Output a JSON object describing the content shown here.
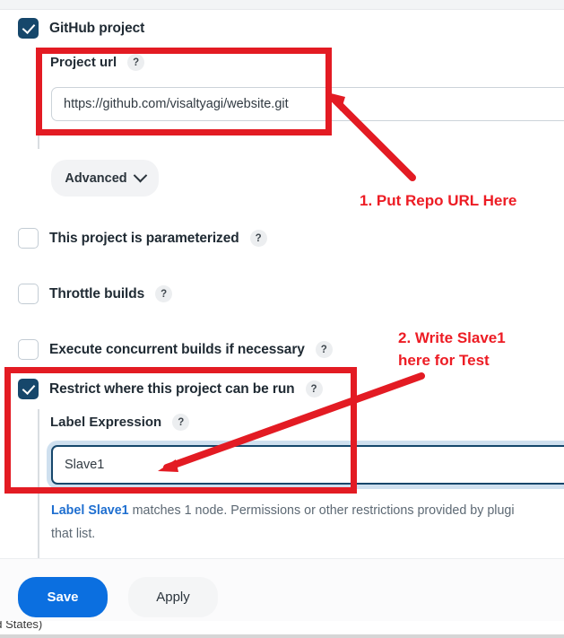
{
  "form": {
    "github_project": {
      "label": "GitHub project",
      "checked": true,
      "project_url_label": "Project url",
      "help_glyph": "?",
      "project_url_value": "https://github.com/visaltyagi/website.git",
      "advanced_label": "Advanced"
    },
    "checkboxes": [
      {
        "label": "This project is parameterized",
        "checked": false,
        "help_glyph": "?"
      },
      {
        "label": "Throttle builds",
        "checked": false,
        "help_glyph": "?"
      },
      {
        "label": "Execute concurrent builds if necessary",
        "checked": false,
        "help_glyph": "?"
      },
      {
        "label": "Restrict where this project can be run",
        "checked": true,
        "help_glyph": "?"
      }
    ],
    "label_expression": {
      "label": "Label Expression",
      "help_glyph": "?",
      "value": "Slave1",
      "note_link": "Label Slave1",
      "note_rest": " matches 1 node. Permissions or other restrictions provided by plugi",
      "note_line2": "that list."
    }
  },
  "footer": {
    "save_label": "Save",
    "apply_label": "Apply"
  },
  "os_bar": {
    "clipped_text": "ed States)"
  },
  "annotations": {
    "note1": "1. Put Repo URL Here",
    "note2": "2. Write Slave1\nhere for Test"
  },
  "colors": {
    "annotation_red": "#ed1c24",
    "box_red": "#e31b23",
    "checkbox_navy": "#16476b",
    "save_blue": "#0b6fe0",
    "link_blue": "#1f6fd0"
  }
}
